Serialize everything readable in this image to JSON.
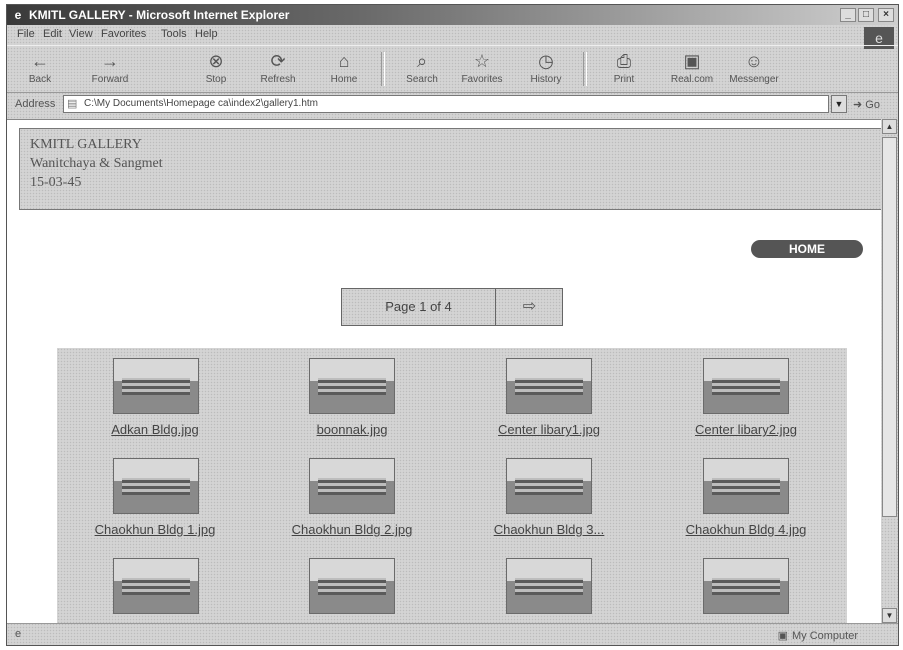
{
  "window": {
    "title": "KMITL GALLERY - Microsoft Internet Explorer"
  },
  "menubar": {
    "items": [
      "File",
      "Edit",
      "View",
      "Favorites",
      "Tools",
      "Help"
    ]
  },
  "toolbar": {
    "buttons": [
      {
        "label": "Back",
        "icon": "back-arrow-icon"
      },
      {
        "label": "Forward",
        "icon": "forward-arrow-icon"
      },
      {
        "label": "Stop",
        "icon": "stop-icon"
      },
      {
        "label": "Refresh",
        "icon": "refresh-icon"
      },
      {
        "label": "Home",
        "icon": "home-icon"
      },
      {
        "label": "Search",
        "icon": "search-icon"
      },
      {
        "label": "Favorites",
        "icon": "favorites-icon"
      },
      {
        "label": "History",
        "icon": "history-icon"
      },
      {
        "label": "Print",
        "icon": "print-icon"
      },
      {
        "label": "Real.com",
        "icon": "real-icon"
      },
      {
        "label": "Messenger",
        "icon": "messenger-icon"
      }
    ]
  },
  "address": {
    "label": "Address",
    "url": "C:\\My Documents\\Homepage ca\\index2\\gallery1.htm",
    "go_label": "Go"
  },
  "page": {
    "header": {
      "title": "KMITL GALLERY",
      "author": "Wanitchaya & Sangmet",
      "date": "15-03-45"
    },
    "home_button": "HOME",
    "pager": {
      "label": "Page 1 of 4"
    },
    "gallery": [
      {
        "caption": "Adkan Bldg.jpg"
      },
      {
        "caption": "boonnak.jpg"
      },
      {
        "caption": "Center libary1.jpg"
      },
      {
        "caption": "Center libary2.jpg"
      },
      {
        "caption": "Chaokhun Bldg 1.jpg"
      },
      {
        "caption": "Chaokhun Bldg 2.jpg"
      },
      {
        "caption": "Chaokhun Bldg 3..."
      },
      {
        "caption": "Chaokhun Bldg 4.jpg"
      },
      {
        "caption": ""
      },
      {
        "caption": ""
      },
      {
        "caption": ""
      },
      {
        "caption": ""
      }
    ]
  },
  "status": {
    "zone": "My Computer"
  }
}
